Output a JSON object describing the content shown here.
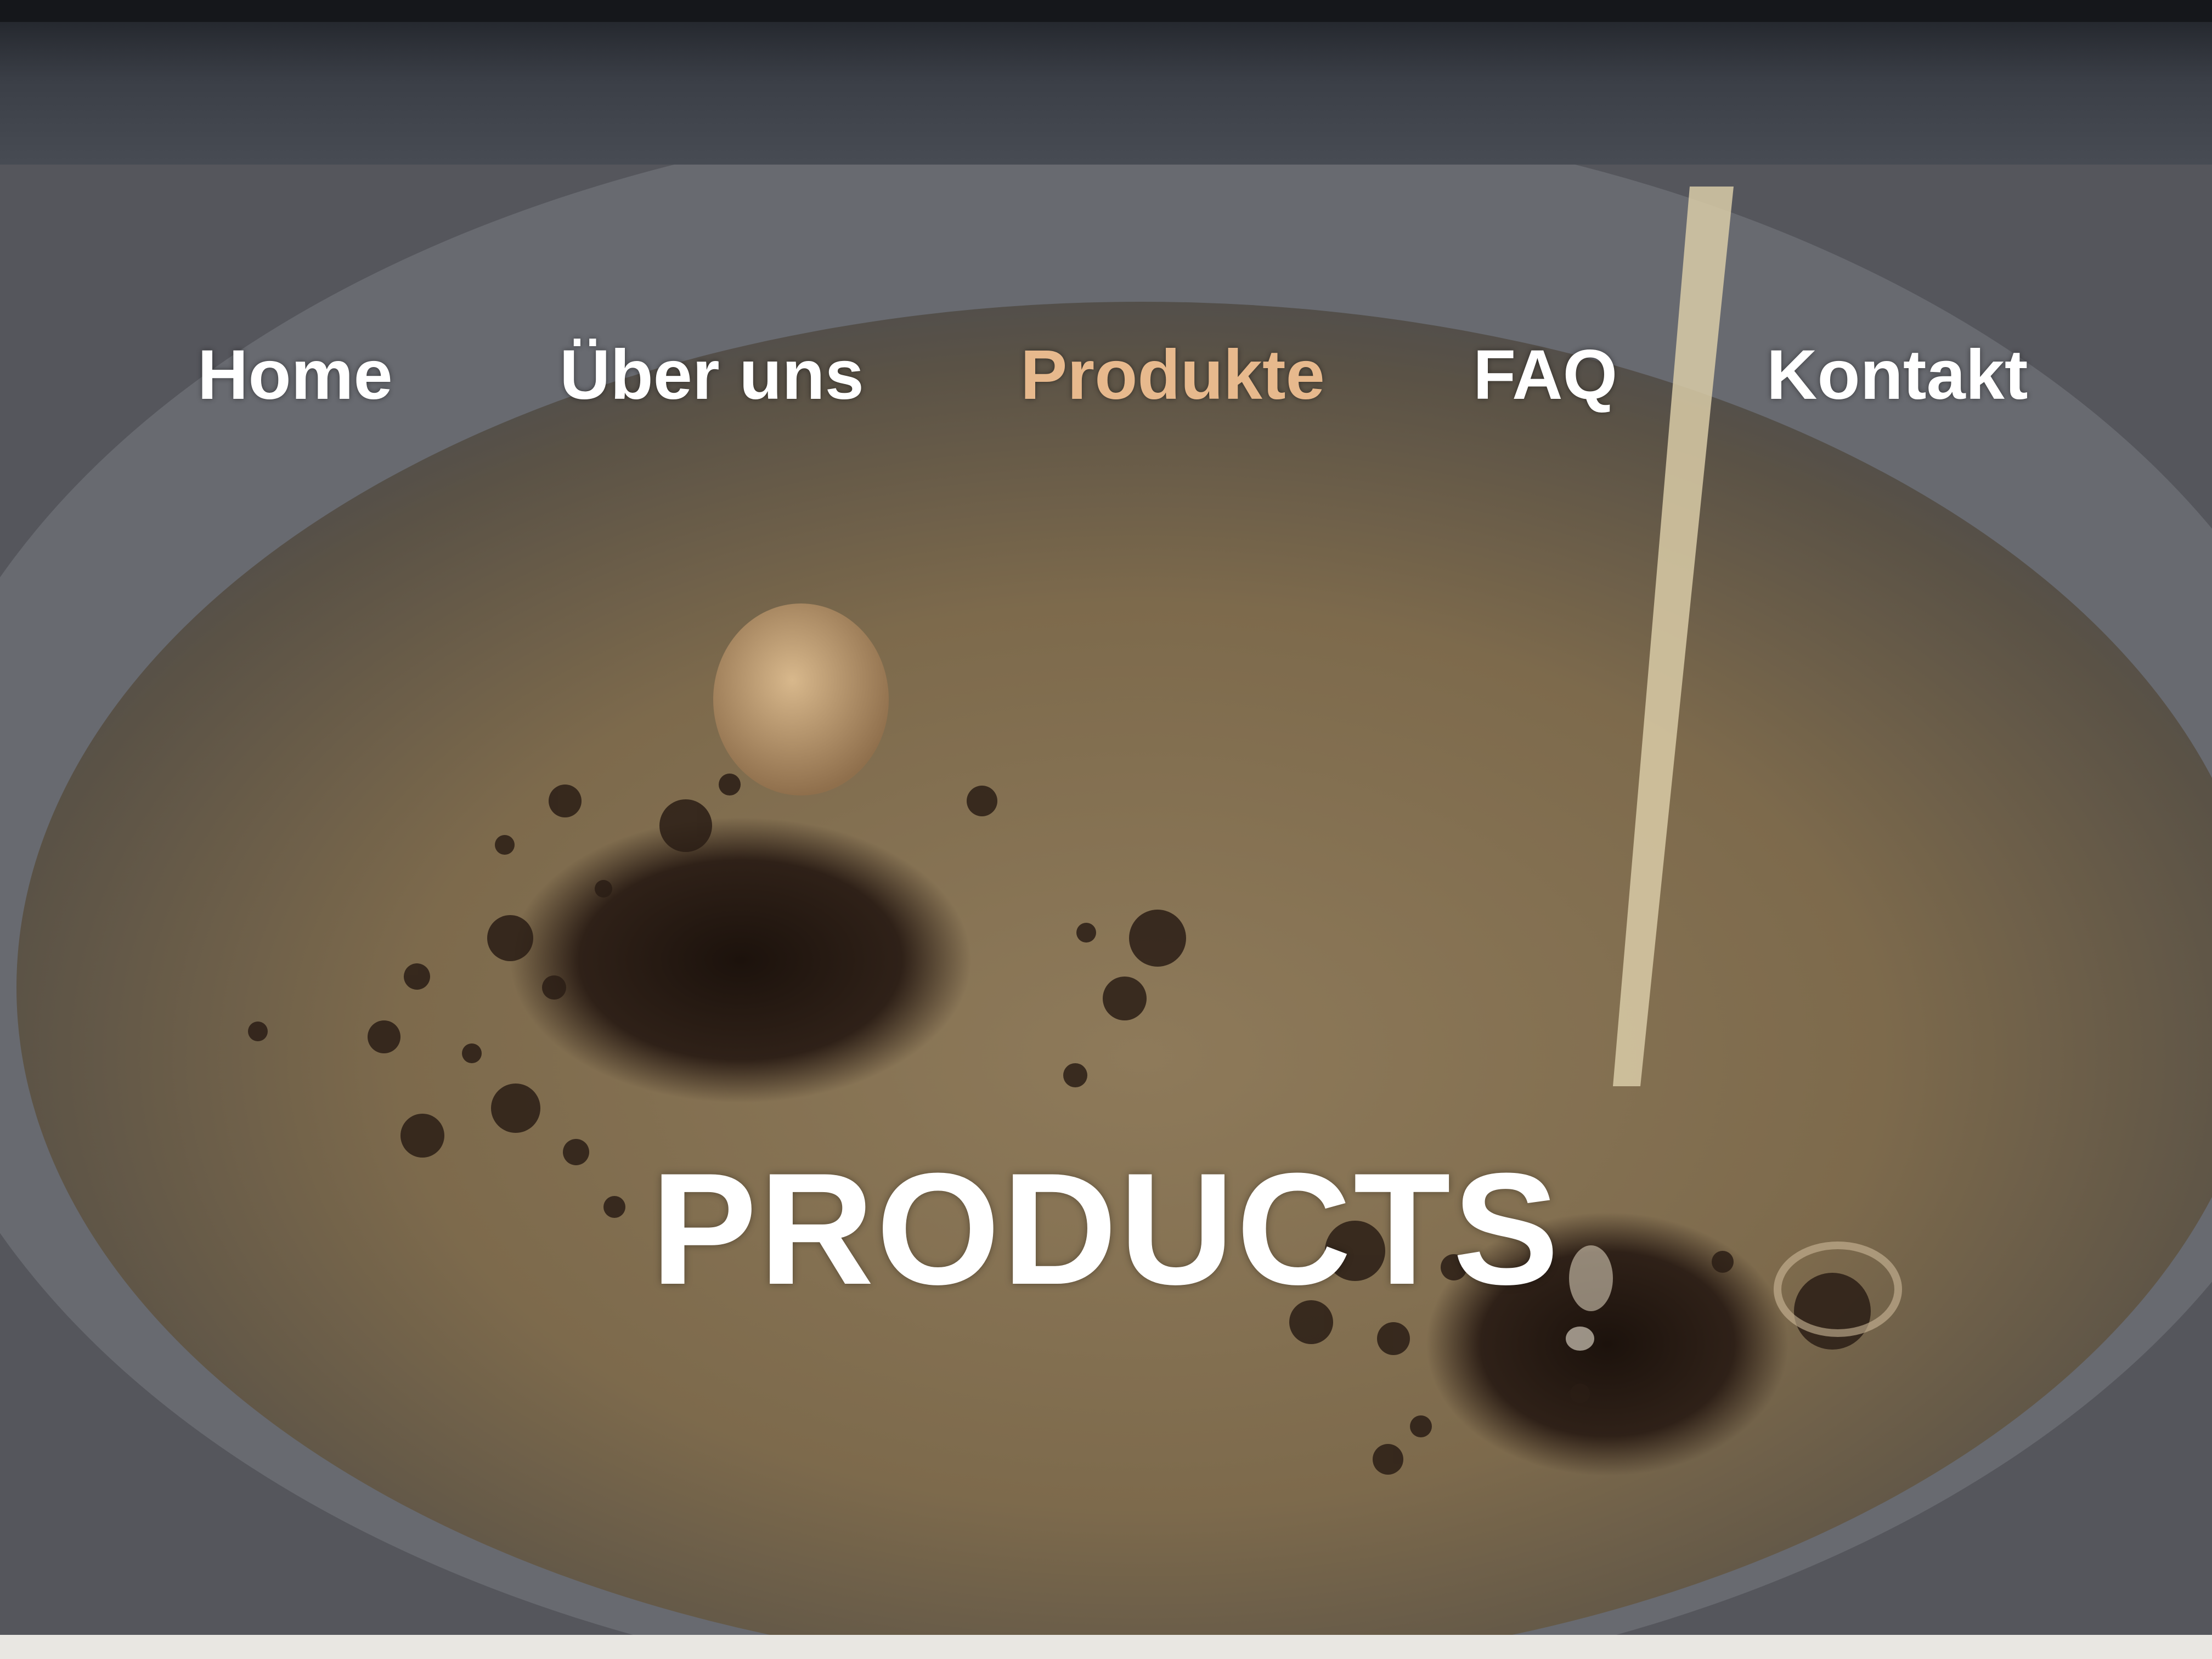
{
  "nav": {
    "items": [
      {
        "label": "Home",
        "active": false
      },
      {
        "label": "Über uns",
        "active": false
      },
      {
        "label": "Produkte",
        "active": true
      },
      {
        "label": "FAQ",
        "active": false
      },
      {
        "label": "Kontakt",
        "active": false
      }
    ]
  },
  "hero": {
    "title": "PRODUCTS"
  },
  "colors": {
    "nav_text": "#ffffff",
    "nav_active": "#e7b98d",
    "title_text": "#ffffff",
    "coffee_crema": "#8a7658"
  }
}
